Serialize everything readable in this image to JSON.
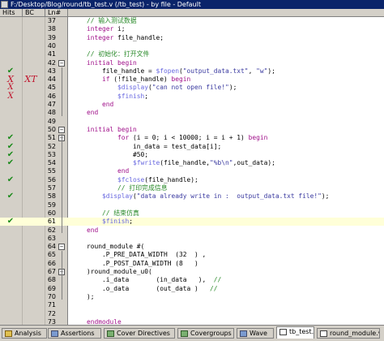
{
  "window": {
    "title": "F:/Desktop/Blog/round/tb_test.v (/tb_test) - by file - Default"
  },
  "columns": {
    "hits": "Hits",
    "bc": "BC",
    "ln": "Ln#"
  },
  "lines": [
    {
      "n": "37",
      "code": "    // 输入测试数据",
      "hits": "",
      "bc": ""
    },
    {
      "n": "38",
      "code": "    integer i;",
      "hits": "",
      "bc": ""
    },
    {
      "n": "39",
      "code": "    integer file_handle;",
      "hits": "",
      "bc": ""
    },
    {
      "n": "40",
      "code": "",
      "hits": "",
      "bc": ""
    },
    {
      "n": "41",
      "code": "    // 初始化：打开文件",
      "hits": "",
      "bc": ""
    },
    {
      "n": "42",
      "code": "    initial begin",
      "hits": "",
      "bc": ""
    },
    {
      "n": "43",
      "code": "        file_handle = $fopen(\"output_data.txt\", \"w\");",
      "hits": "ok",
      "bc": ""
    },
    {
      "n": "44",
      "code": "        if (!file_handle) begin",
      "hits": "xb",
      "bc": "xt"
    },
    {
      "n": "45",
      "code": "            $display(\"can not open file!\");",
      "hits": "xs",
      "bc": ""
    },
    {
      "n": "46",
      "code": "            $finish;",
      "hits": "xs",
      "bc": ""
    },
    {
      "n": "47",
      "code": "        end",
      "hits": "",
      "bc": ""
    },
    {
      "n": "48",
      "code": "    end",
      "hits": "",
      "bc": ""
    },
    {
      "n": "49",
      "code": "",
      "hits": "",
      "bc": ""
    },
    {
      "n": "50",
      "code": "    initial begin",
      "hits": "",
      "bc": ""
    },
    {
      "n": "51",
      "code": "            for (i = 0; i < 10000; i = i + 1) begin",
      "hits": "ok",
      "bc": ""
    },
    {
      "n": "52",
      "code": "                in_data = test_data[i];",
      "hits": "ok",
      "bc": ""
    },
    {
      "n": "53",
      "code": "                #50;",
      "hits": "ok",
      "bc": ""
    },
    {
      "n": "54",
      "code": "                $fwrite(file_handle,\"%b\\n\",out_data);",
      "hits": "ok",
      "bc": ""
    },
    {
      "n": "55",
      "code": "            end",
      "hits": "",
      "bc": ""
    },
    {
      "n": "56",
      "code": "            $fclose(file_handle);",
      "hits": "ok",
      "bc": ""
    },
    {
      "n": "57",
      "code": "            // 打印完成信息",
      "hits": "",
      "bc": ""
    },
    {
      "n": "58",
      "code": "        $display(\"data already write in :  output_data.txt file!\");",
      "hits": "ok",
      "bc": ""
    },
    {
      "n": "59",
      "code": "",
      "hits": "",
      "bc": ""
    },
    {
      "n": "60",
      "code": "        // 结束仿真",
      "hits": "",
      "bc": ""
    },
    {
      "n": "61",
      "code": "        $finish;",
      "hits": "ok",
      "bc": ""
    },
    {
      "n": "62",
      "code": "    end",
      "hits": "",
      "bc": ""
    },
    {
      "n": "63",
      "code": "",
      "hits": "",
      "bc": ""
    },
    {
      "n": "64",
      "code": "    round_module #(",
      "hits": "",
      "bc": ""
    },
    {
      "n": "65",
      "code": "        .P_PRE_DATA_WIDTH  (32  ) ,",
      "hits": "",
      "bc": ""
    },
    {
      "n": "66",
      "code": "        .P_POST_DATA_WIDTH (8   )",
      "hits": "",
      "bc": ""
    },
    {
      "n": "67",
      "code": "    )round_module_u0(",
      "hits": "",
      "bc": ""
    },
    {
      "n": "68",
      "code": "        .i_data       (in_data   ),  //",
      "hits": "",
      "bc": ""
    },
    {
      "n": "69",
      "code": "        .o_data       (out_data )   //",
      "hits": "",
      "bc": ""
    },
    {
      "n": "70",
      "code": "    );",
      "hits": "",
      "bc": ""
    },
    {
      "n": "71",
      "code": "",
      "hits": "",
      "bc": ""
    },
    {
      "n": "72",
      "code": "",
      "hits": "",
      "bc": ""
    },
    {
      "n": "73",
      "code": "    endmodule",
      "hits": "",
      "bc": ""
    }
  ],
  "marks": {
    "ok": "✔",
    "x": "X",
    "xt": "XT"
  },
  "tabs": [
    {
      "label": "Analysis",
      "icon": "analysis-icon",
      "color": "y"
    },
    {
      "label": "Assertions",
      "icon": "assertions-icon",
      "color": "b"
    },
    {
      "label": "Cover Directives",
      "icon": "cover-directives-icon",
      "color": "g"
    },
    {
      "label": "Covergroups",
      "icon": "covergroups-icon",
      "color": "g"
    },
    {
      "label": "Wave",
      "icon": "wave-icon",
      "color": "b"
    },
    {
      "label": "tb_test.v",
      "icon": "source-file-icon",
      "color": "w"
    },
    {
      "label": "round_module.v",
      "icon": "source-file-icon",
      "color": "w"
    }
  ],
  "colors": {
    "keyword": "#a0108a",
    "comment": "#2a8a2a",
    "string": "#3a3aa0",
    "system_task": "#6868e0",
    "covered": "#1b8a1b",
    "missed": "#c0142c",
    "titlebar": "#0a246a"
  }
}
